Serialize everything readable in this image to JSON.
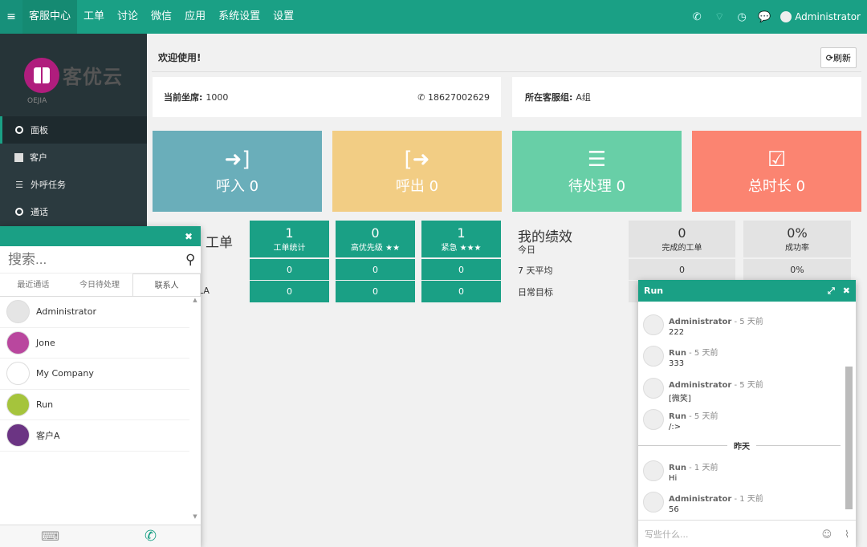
{
  "topbar": {
    "nav": [
      "客服中心",
      "工单",
      "讨论",
      "微信",
      "应用",
      "系统设置",
      "设置"
    ],
    "user": "Administrator"
  },
  "sidebar": {
    "logo_text": "客优云",
    "logo_sub": "OEJIA",
    "items": [
      "面板",
      "客户",
      "外呼任务",
      "通话"
    ]
  },
  "main": {
    "welcome": "欢迎使用!",
    "refresh": "刷新",
    "seat_label": "当前坐席:",
    "seat_value": "1000",
    "phone": "18627002629",
    "group_label": "所在客服组:",
    "group_value": "A组"
  },
  "stats": [
    {
      "label": "呼入",
      "value": "0",
      "color": "#6aaeba"
    },
    {
      "label": "呼出",
      "value": "0",
      "color": "#f2cd84"
    },
    {
      "label": "待处理",
      "value": "0",
      "color": "#68cfa7"
    },
    {
      "label": "总时长",
      "value": "0",
      "color": "#fb8471"
    }
  ],
  "tickets": {
    "title_partial": "工单",
    "row3_partial": "LA",
    "cols": [
      {
        "n": "1",
        "l": "工单统计",
        "r2": "0",
        "r3": "0"
      },
      {
        "n": "0",
        "l": "高优先级 ★★",
        "r2": "0",
        "r3": "0"
      },
      {
        "n": "1",
        "l": "紧急 ★★★",
        "r2": "0",
        "r3": "0"
      }
    ]
  },
  "perf": {
    "title": "我的绩效",
    "rows": [
      "今日",
      "7 天平均",
      "日常目标"
    ],
    "cols": [
      {
        "n": "0",
        "l": "完成的工单",
        "r2": "0"
      },
      {
        "n": "0%",
        "l": "成功率",
        "r2": "0%"
      }
    ]
  },
  "contacts": {
    "search_placeholder": "搜索...",
    "tabs": [
      "最近通话",
      "今日待处理",
      "联系人"
    ],
    "list": [
      {
        "name": "Administrator",
        "color": "#e5e5e5"
      },
      {
        "name": "Jone",
        "color": "#b9479e"
      },
      {
        "name": "My Company",
        "color": "#ffffff"
      },
      {
        "name": "Run",
        "color": "#a5c43c"
      },
      {
        "name": "客户A",
        "color": "#6b3483"
      }
    ]
  },
  "chat": {
    "title": "Run",
    "messages": [
      {
        "who": "Administrator",
        "when": "- 5 天前",
        "text": "222"
      },
      {
        "who": "Run",
        "when": "- 5 天前",
        "text": "333"
      },
      {
        "who": "Administrator",
        "when": "- 5 天前",
        "text": "[微笑]"
      },
      {
        "who": "Run",
        "when": "- 5 天前",
        "text": "/:>"
      }
    ],
    "separator": "昨天",
    "messages2": [
      {
        "who": "Run",
        "when": "- 1 天前",
        "text": "Hi"
      },
      {
        "who": "Administrator",
        "when": "- 1 天前",
        "text": "56"
      }
    ],
    "input_placeholder": "写些什么..."
  }
}
